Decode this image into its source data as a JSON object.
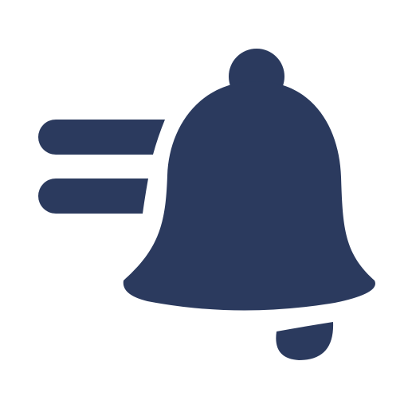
{
  "icon": {
    "name": "notification-bell-icon",
    "color": "#2B3A5E",
    "background": "#FFFFFF"
  }
}
